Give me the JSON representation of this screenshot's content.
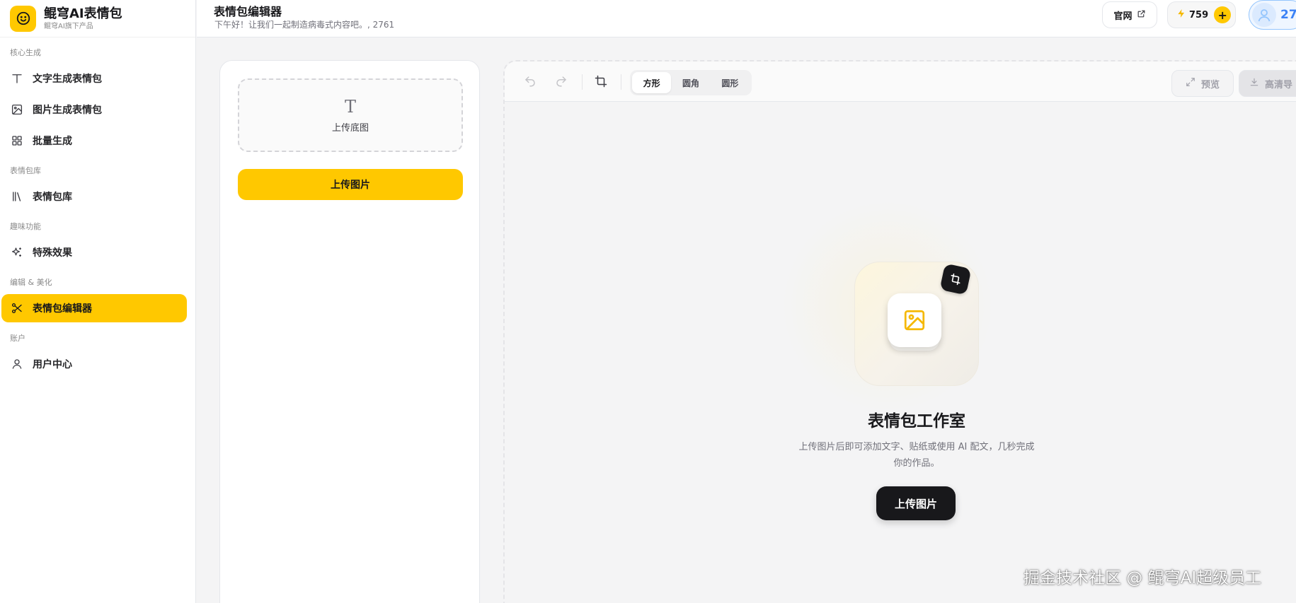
{
  "brand": {
    "title": "鲲穹AI表情包",
    "subtitle": "鲲穹AI旗下产品",
    "logo_icon": "smiley-icon",
    "accent": "#ffc800"
  },
  "sidebar": {
    "groups": [
      {
        "title": "核心生成",
        "items": [
          {
            "label": "文字生成表情包",
            "icon": "text-icon"
          },
          {
            "label": "图片生成表情包",
            "icon": "image-icon"
          },
          {
            "label": "批量生成",
            "icon": "grid-icon"
          }
        ]
      },
      {
        "title": "表情包库",
        "items": [
          {
            "label": "表情包库",
            "icon": "library-icon"
          }
        ]
      },
      {
        "title": "趣味功能",
        "items": [
          {
            "label": "特殊效果",
            "icon": "sparkles-icon"
          }
        ]
      },
      {
        "title": "编辑 & 美化",
        "items": [
          {
            "label": "表情包编辑器",
            "icon": "scissors-icon",
            "active": true
          }
        ]
      },
      {
        "title": "账户",
        "items": [
          {
            "label": "用户中心",
            "icon": "user-icon"
          }
        ]
      }
    ]
  },
  "header": {
    "title": "表情包编辑器",
    "subtitle": "下午好！让我们一起制造病毒式内容吧。, 2761",
    "official_site": "官网",
    "credits": "759",
    "user_count": "27"
  },
  "left_panel": {
    "upload_zone_icon": "T",
    "upload_zone_label": "上传底图",
    "upload_button": "上传图片"
  },
  "toolbar": {
    "shapes": [
      "方形",
      "圆角",
      "圆形"
    ],
    "active_shape": "方形",
    "preview": "预览",
    "export": "高清导"
  },
  "studio": {
    "title": "表情包工作室",
    "description_line1": "上传图片后即可添加文字、贴纸或使用 AI 配文，几秒完成",
    "description_line2": "你的作品。",
    "button": "上传图片"
  },
  "watermark": "掘金技术社区 @ 鲲穹AI超级员工"
}
